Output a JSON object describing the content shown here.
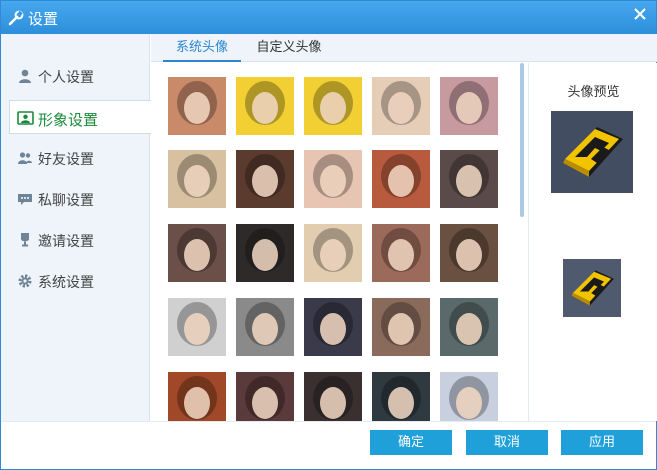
{
  "window": {
    "title": "设置"
  },
  "sidebar": {
    "items": [
      {
        "label": "个人设置",
        "icon": "user-icon"
      },
      {
        "label": "形象设置",
        "icon": "portrait-icon",
        "active": true
      },
      {
        "label": "好友设置",
        "icon": "friends-icon"
      },
      {
        "label": "私聊设置",
        "icon": "chat-bubble-icon"
      },
      {
        "label": "邀请设置",
        "icon": "trophy-icon"
      },
      {
        "label": "系统设置",
        "icon": "gear-icon"
      }
    ]
  },
  "tabs": [
    {
      "label": "系统头像",
      "active": true
    },
    {
      "label": "自定义头像"
    }
  ],
  "avatars": [
    [
      "#c98a6a",
      "#f2d034",
      "#f2d034",
      "#e6cdb7",
      "#c79aa0"
    ],
    [
      "#d7c1a0",
      "#5a3b2e",
      "#e8c5b2",
      "#b85a3e",
      "#5a4a4a"
    ],
    [
      "#6a5048",
      "#2e2a2a",
      "#e2cdb0",
      "#9b6a5a",
      "#6a5040"
    ],
    [
      "#d0d0d0",
      "#8a8a8a",
      "#3a3a4a",
      "#8a6a5a",
      "#5a6a6a"
    ],
    [
      "#a04828",
      "#5a3a3a",
      "#3a3030",
      "#2e3a40",
      "#c8d0e0"
    ]
  ],
  "preview": {
    "title": "头像预览",
    "icon": "game-logo-icon"
  },
  "footer": {
    "confirm_label": "确定",
    "cancel_label": "取消",
    "apply_label": "应用"
  },
  "colors": {
    "accent": "#2b86cf",
    "active_green": "#1a8a3a",
    "button": "#20a0d8"
  }
}
